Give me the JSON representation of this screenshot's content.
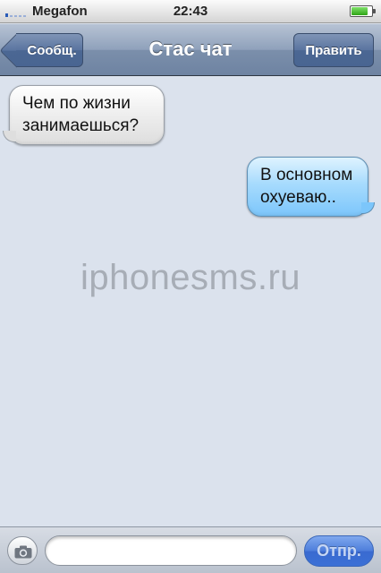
{
  "status_bar": {
    "carrier": "Megafon",
    "time": "22:43",
    "battery_level": 0.8
  },
  "nav_bar": {
    "back_label": "Сообщ.",
    "title": "Стас чат",
    "edit_label": "Править"
  },
  "messages": [
    {
      "direction": "incoming",
      "text": "Чем по жизни занимаешься?"
    },
    {
      "direction": "outgoing",
      "text": "В основном охуеваю.."
    }
  ],
  "watermark": "iphonesms.ru",
  "input_bar": {
    "message_value": "",
    "send_label": "Отпр."
  },
  "colors": {
    "background": "#dbe2ed",
    "nav_bar": "#8fa1bb",
    "outgoing_bubble": "#a7dbfd",
    "incoming_bubble": "#ececec",
    "send_button": "#4d7ddb"
  }
}
